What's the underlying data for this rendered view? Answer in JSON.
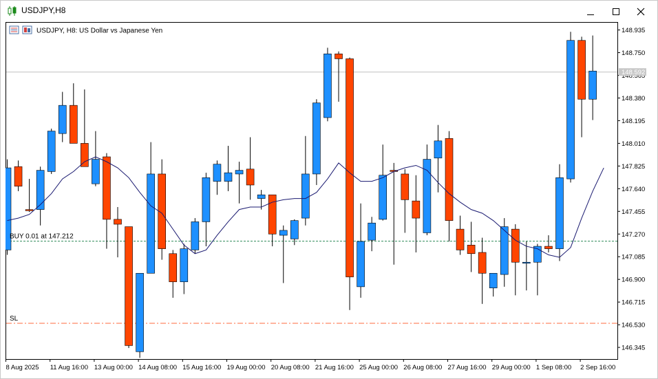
{
  "window": {
    "title": "USDJPY,H8",
    "title_icon": "candlestick-chart-icon",
    "controls": [
      "minimize-icon",
      "maximize-icon",
      "close-icon"
    ]
  },
  "chart_data": {
    "type": "candlestick",
    "title": "USDJPY, H8:  US Dollar vs Japanese Yen",
    "symbol": "USDJPY",
    "timeframe": "H8",
    "ylim": [
      146.25,
      149.0
    ],
    "y_ticks": [
      "148.935",
      "148.750",
      "148.565",
      "148.380",
      "148.195",
      "148.010",
      "147.825",
      "147.640",
      "147.455",
      "147.270",
      "147.085",
      "146.900",
      "146.715",
      "146.530",
      "146.345"
    ],
    "x_ticks": [
      {
        "index": 0,
        "label": "8 Aug 2025"
      },
      {
        "index": 4,
        "label": "11 Aug 16:00"
      },
      {
        "index": 8,
        "label": "13 Aug 00:00"
      },
      {
        "index": 12,
        "label": "14 Aug 08:00"
      },
      {
        "index": 16,
        "label": "15 Aug 16:00"
      },
      {
        "index": 20,
        "label": "19 Aug 00:00"
      },
      {
        "index": 24,
        "label": "20 Aug 08:00"
      },
      {
        "index": 28,
        "label": "21 Aug 16:00"
      },
      {
        "index": 32,
        "label": "25 Aug 00:00"
      },
      {
        "index": 36,
        "label": "26 Aug 08:00"
      },
      {
        "index": 40,
        "label": "27 Aug 16:00"
      },
      {
        "index": 44,
        "label": "29 Aug 00:00"
      },
      {
        "index": 48,
        "label": "1 Sep 08:00"
      },
      {
        "index": 52,
        "label": "2 Sep 16:00"
      }
    ],
    "candles": [
      {
        "o": 147.14,
        "h": 147.88,
        "l": 147.1,
        "c": 147.81
      },
      {
        "o": 147.82,
        "h": 147.87,
        "l": 147.62,
        "c": 147.66
      },
      {
        "o": 147.47,
        "h": 147.72,
        "l": 147.45,
        "c": 147.46
      },
      {
        "o": 147.47,
        "h": 147.82,
        "l": 147.34,
        "c": 147.79
      },
      {
        "o": 147.78,
        "h": 148.13,
        "l": 147.76,
        "c": 148.11
      },
      {
        "o": 148.09,
        "h": 148.43,
        "l": 148.02,
        "c": 148.32
      },
      {
        "o": 148.32,
        "h": 148.5,
        "l": 148.02,
        "c": 148.01
      },
      {
        "o": 148.01,
        "h": 148.45,
        "l": 147.82,
        "c": 147.82
      },
      {
        "o": 147.68,
        "h": 148.11,
        "l": 147.66,
        "c": 147.88
      },
      {
        "o": 147.9,
        "h": 147.93,
        "l": 147.15,
        "c": 147.39
      },
      {
        "o": 147.39,
        "h": 147.49,
        "l": 147.08,
        "c": 147.35
      },
      {
        "o": 147.33,
        "h": 147.33,
        "l": 146.34,
        "c": 146.36
      },
      {
        "o": 146.31,
        "h": 146.95,
        "l": 146.26,
        "c": 146.95
      },
      {
        "o": 146.95,
        "h": 148.02,
        "l": 146.95,
        "c": 147.76
      },
      {
        "o": 147.76,
        "h": 147.88,
        "l": 147.06,
        "c": 147.15
      },
      {
        "o": 147.11,
        "h": 147.14,
        "l": 146.75,
        "c": 146.88
      },
      {
        "o": 146.88,
        "h": 147.19,
        "l": 146.78,
        "c": 147.15
      },
      {
        "o": 147.14,
        "h": 147.4,
        "l": 147.11,
        "c": 147.37
      },
      {
        "o": 147.37,
        "h": 147.77,
        "l": 147.17,
        "c": 147.73
      },
      {
        "o": 147.7,
        "h": 147.87,
        "l": 147.59,
        "c": 147.84
      },
      {
        "o": 147.7,
        "h": 147.99,
        "l": 147.62,
        "c": 147.77
      },
      {
        "o": 147.76,
        "h": 147.86,
        "l": 147.52,
        "c": 147.79
      },
      {
        "o": 147.8,
        "h": 148.06,
        "l": 147.55,
        "c": 147.67
      },
      {
        "o": 147.56,
        "h": 147.63,
        "l": 147.47,
        "c": 147.59
      },
      {
        "o": 147.59,
        "h": 147.59,
        "l": 147.17,
        "c": 147.27
      },
      {
        "o": 147.26,
        "h": 147.34,
        "l": 146.87,
        "c": 147.3
      },
      {
        "o": 147.23,
        "h": 147.39,
        "l": 147.18,
        "c": 147.38
      },
      {
        "o": 147.4,
        "h": 148.07,
        "l": 147.34,
        "c": 147.76
      },
      {
        "o": 147.76,
        "h": 148.37,
        "l": 147.67,
        "c": 148.34
      },
      {
        "o": 148.22,
        "h": 148.79,
        "l": 148.19,
        "c": 148.74
      },
      {
        "o": 148.74,
        "h": 148.76,
        "l": 148.35,
        "c": 148.7
      },
      {
        "o": 148.7,
        "h": 148.71,
        "l": 146.65,
        "c": 146.92
      },
      {
        "o": 146.84,
        "h": 147.52,
        "l": 146.75,
        "c": 147.21
      },
      {
        "o": 147.22,
        "h": 147.41,
        "l": 147.13,
        "c": 147.36
      },
      {
        "o": 147.39,
        "h": 148.0,
        "l": 147.38,
        "c": 147.75
      },
      {
        "o": 147.79,
        "h": 147.85,
        "l": 147.02,
        "c": 147.78
      },
      {
        "o": 147.76,
        "h": 147.8,
        "l": 147.28,
        "c": 147.55
      },
      {
        "o": 147.54,
        "h": 147.75,
        "l": 147.12,
        "c": 147.4
      },
      {
        "o": 147.28,
        "h": 148.0,
        "l": 147.26,
        "c": 147.88
      },
      {
        "o": 147.89,
        "h": 148.16,
        "l": 147.61,
        "c": 148.03
      },
      {
        "o": 148.05,
        "h": 148.11,
        "l": 147.21,
        "c": 147.38
      },
      {
        "o": 147.31,
        "h": 147.42,
        "l": 147.1,
        "c": 147.14
      },
      {
        "o": 147.18,
        "h": 147.37,
        "l": 146.96,
        "c": 147.11
      },
      {
        "o": 147.12,
        "h": 147.24,
        "l": 146.7,
        "c": 146.95
      },
      {
        "o": 146.83,
        "h": 146.95,
        "l": 146.76,
        "c": 146.95
      },
      {
        "o": 146.94,
        "h": 147.4,
        "l": 146.84,
        "c": 147.33
      },
      {
        "o": 147.31,
        "h": 147.35,
        "l": 146.77,
        "c": 147.04
      },
      {
        "o": 147.04,
        "h": 147.21,
        "l": 146.81,
        "c": 147.04
      },
      {
        "o": 147.04,
        "h": 147.19,
        "l": 146.77,
        "c": 147.17
      },
      {
        "o": 147.17,
        "h": 147.26,
        "l": 147.12,
        "c": 147.15
      },
      {
        "o": 147.15,
        "h": 147.84,
        "l": 147.05,
        "c": 147.73
      },
      {
        "o": 147.72,
        "h": 148.92,
        "l": 147.69,
        "c": 148.85
      },
      {
        "o": 148.85,
        "h": 148.88,
        "l": 148.06,
        "c": 148.37
      },
      {
        "o": 148.37,
        "h": 148.89,
        "l": 148.2,
        "c": 148.6
      }
    ],
    "moving_average": {
      "color": "#191970",
      "values": [
        147.38,
        147.4,
        147.43,
        147.51,
        147.6,
        147.72,
        147.78,
        147.86,
        147.9,
        147.86,
        147.81,
        147.73,
        147.61,
        147.5,
        147.44,
        147.31,
        147.18,
        147.11,
        147.14,
        147.26,
        147.37,
        147.47,
        147.49,
        147.49,
        147.53,
        147.55,
        147.56,
        147.56,
        147.61,
        147.72,
        147.85,
        147.77,
        147.7,
        147.7,
        147.73,
        147.78,
        147.81,
        147.83,
        147.79,
        147.69,
        147.6,
        147.53,
        147.47,
        147.44,
        147.38,
        147.3,
        147.22,
        147.17,
        147.15,
        147.1,
        147.08,
        147.16,
        147.4,
        147.62,
        147.81
      ]
    },
    "current_price": {
      "value": 148.592,
      "label": "148.592"
    },
    "order_line": {
      "price": 147.212,
      "label": "BUY 0.01 at 147.212",
      "color": "#2e8b57"
    },
    "sl_line": {
      "price": 146.542,
      "label": "SL",
      "color": "#ff6a3d"
    },
    "colors": {
      "bull": "#1e90ff",
      "bear": "#ff4500",
      "wick": "#000000",
      "grid_price_line": "#c0c0c0",
      "price_tag_bg": "#c8c8c8"
    },
    "header_icons": [
      "trade-panel-icon",
      "chart-flag-icon"
    ]
  }
}
